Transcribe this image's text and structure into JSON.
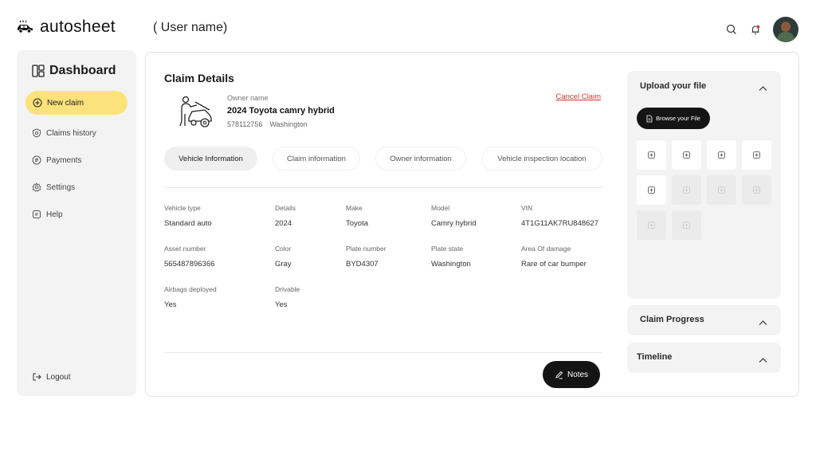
{
  "brand": {
    "name": "autosheet"
  },
  "header": {
    "user_name": "( User name)"
  },
  "sidebar": {
    "title": "Dashboard",
    "new_claim": "New claim",
    "items": [
      {
        "label": "Claims history",
        "icon": "shield-icon"
      },
      {
        "label": "Payments",
        "icon": "payments-icon"
      },
      {
        "label": "Settings",
        "icon": "gear-icon"
      },
      {
        "label": "Help",
        "icon": "help-icon"
      }
    ],
    "logout": "Logout"
  },
  "claim": {
    "title": "Claim Details",
    "owner_label": "Owner name",
    "vehicle": "2024 Toyota camry hybrid",
    "owner_id": "578112756",
    "owner_location": "Washington",
    "cancel_label": "Cancel Claim",
    "tabs": [
      {
        "label": "Vehicle Information",
        "active": true
      },
      {
        "label": "Claim information",
        "active": false
      },
      {
        "label": "Owner information",
        "active": false
      },
      {
        "label": "Vehicle inspection location",
        "active": false
      }
    ],
    "fields": {
      "vehicle_type": {
        "label": "Vehicle type",
        "value": "Standard auto"
      },
      "details": {
        "label": "Details",
        "value": "2024"
      },
      "make": {
        "label": "Make",
        "value": "Toyota"
      },
      "model": {
        "label": "Model",
        "value": "Camry hybrid"
      },
      "vin": {
        "label": "VIN",
        "value": "4T1G11AK7RU848627"
      },
      "asset_number": {
        "label": "Asset number",
        "value": "565487896366"
      },
      "color": {
        "label": "Color",
        "value": "Gray"
      },
      "plate_number": {
        "label": "Plate number",
        "value": "BYD4307"
      },
      "plate_state": {
        "label": "Plate state",
        "value": "Washington"
      },
      "area_of_damage": {
        "label": "Area Of damage",
        "value": "Rare of car bumper"
      },
      "airbags": {
        "label": "Airbags deployed",
        "value": "Yes"
      },
      "drivable": {
        "label": "Drivable",
        "value": "Yes"
      }
    },
    "notes_label": "Notes"
  },
  "upload": {
    "title": "Upload your file",
    "browse_label": "Browse your File",
    "slots": [
      "filled",
      "filled",
      "filled",
      "filled",
      "filled",
      "empty",
      "empty",
      "empty",
      "empty",
      "empty"
    ]
  },
  "panels": {
    "claim_progress": "Claim Progress",
    "timeline": "Timeline"
  },
  "colors": {
    "accent_yellow": "#fbe27a",
    "danger_red": "#e03131",
    "dark_button": "#141414",
    "panel_gray": "#f3f3f3"
  }
}
